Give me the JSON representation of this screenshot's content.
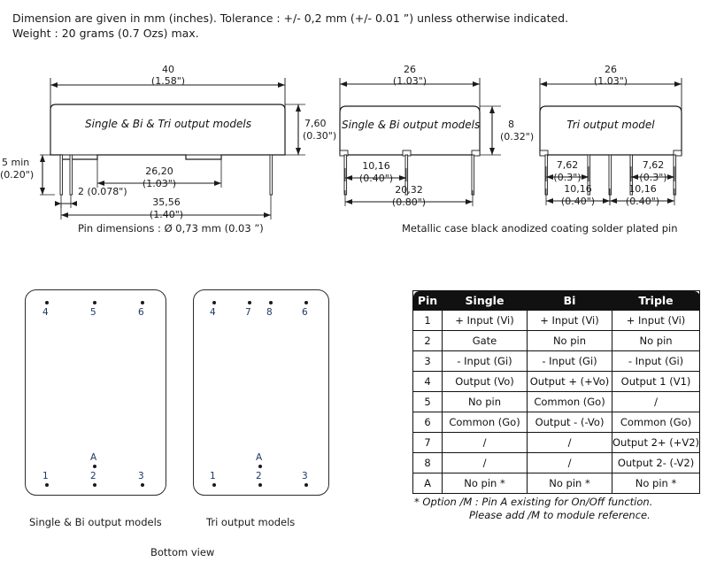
{
  "header": {
    "line1": "Dimension are given in mm (inches). Tolerance : +/- 0,2 mm (+/- 0.01 ”) unless otherwise indicated.",
    "line2": "Weight : 20 grams (0.7 Ozs) max."
  },
  "drawing1": {
    "body_label": "Single & Bi & Tri output models",
    "width_mm": "40",
    "width_in": "(1.58\")",
    "height_mm": "7,60",
    "height_in": "(0.30\")",
    "pinlen_mm": "5 min",
    "pinlen_in": "(0.20\")",
    "pinpitch": "2 (0.078\")",
    "inner_mm": "26,20",
    "inner_in": "(1.03\")",
    "outer_mm": "35,56",
    "outer_in": "(1.40\")",
    "caption": "Pin dimensions :  Ø  0,73 mm (0.03 ”)"
  },
  "drawing2": {
    "body_label": "Single & Bi output models",
    "width_mm": "26",
    "width_in": "(1.03\")",
    "height_mm": "8",
    "height_in": "(0.32\")",
    "pitch1_mm": "10,16",
    "pitch1_in": "(0.40\")",
    "span_mm": "20,32",
    "span_in": "(0.80\")"
  },
  "drawing3": {
    "body_label": "Tri output model",
    "width_mm": "26",
    "width_in": "(1.03\")",
    "pitchL_mm": "7,62",
    "pitchL_in": "(0.3\")",
    "pitchR_mm": "7,62",
    "pitchR_in": "(0.3\")",
    "spanL_mm": "10,16",
    "spanL_in": "(0.40\")",
    "spanR_mm": "10,16",
    "spanR_in": "(0.40\")",
    "caption": "Metallic case black anodized coating solder plated pin"
  },
  "bottom_view": {
    "left": {
      "caption": "Single & Bi output models",
      "top_pins": [
        "4",
        "5",
        "6"
      ],
      "bottom_pins": [
        "1",
        "2",
        "3"
      ],
      "extra_pin": "A"
    },
    "right": {
      "caption": "Tri output models",
      "top_pins": [
        "4",
        "7",
        "8",
        "6"
      ],
      "bottom_pins": [
        "1",
        "2",
        "3"
      ],
      "extra_pin": "A"
    },
    "caption": "Bottom view"
  },
  "pin_table": {
    "headers": [
      "Pin",
      "Single",
      "Bi",
      "Triple"
    ],
    "rows": [
      [
        "1",
        "+ Input (Vi)",
        "+ Input (Vi)",
        "+ Input (Vi)"
      ],
      [
        "2",
        "Gate",
        "No pin",
        "No pin"
      ],
      [
        "3",
        "- Input (Gi)",
        "- Input (Gi)",
        "- Input (Gi)"
      ],
      [
        "4",
        "Output (Vo)",
        "Output + (+Vo)",
        "Output 1 (V1)"
      ],
      [
        "5",
        "No pin",
        "Common (Go)",
        "/"
      ],
      [
        "6",
        "Common (Go)",
        "Output - (-Vo)",
        "Common (Go)"
      ],
      [
        "7",
        "/",
        "/",
        "Output 2+ (+V2)"
      ],
      [
        "8",
        "/",
        "/",
        "Output 2- (-V2)"
      ],
      [
        "A",
        "No pin *",
        "No pin *",
        "No pin *"
      ]
    ],
    "footnote_line1": "* Option /M : Pin A existing for On/Off function.",
    "footnote_line2": "Please add /M to module reference."
  },
  "colors": {
    "line": "#1a1a1a",
    "pin_number": "#1f3864",
    "table_header_bg": "#111111"
  }
}
